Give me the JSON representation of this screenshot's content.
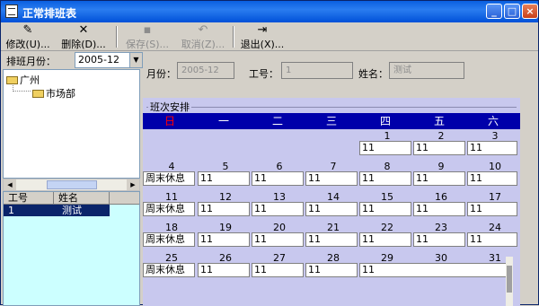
{
  "window": {
    "title": "正常排班表",
    "min": "_",
    "max": "□",
    "close": "×"
  },
  "toolbar": [
    {
      "label": "修改(U)...",
      "icon": "edit-icon",
      "glyph": "✎",
      "enabled": true
    },
    {
      "label": "删除(D)...",
      "icon": "delete-icon",
      "glyph": "✕",
      "enabled": true
    },
    {
      "label": "保存(S)...",
      "icon": "save-icon",
      "glyph": "▪",
      "enabled": false
    },
    {
      "label": "取消(Z)...",
      "icon": "undo-icon",
      "glyph": "↶",
      "enabled": false
    },
    {
      "label": "退出(X)...",
      "icon": "exit-icon",
      "glyph": "⇥",
      "enabled": true
    }
  ],
  "month": {
    "label": "排班月份：",
    "value": "2005-12"
  },
  "tree": {
    "root": "广州",
    "child": "市场部"
  },
  "employees": {
    "headers": [
      "工号",
      "姓名"
    ],
    "rows": [
      {
        "id": "1",
        "name": "测试"
      }
    ]
  },
  "form": {
    "month_label": "月份：",
    "month_value": "2005-12",
    "id_label": "工号：",
    "id_value": "1",
    "name_label": "姓名：",
    "name_value": "测试"
  },
  "schedule": {
    "title": "班次安排",
    "days": [
      "日",
      "一",
      "二",
      "三",
      "四",
      "五",
      "六"
    ],
    "weekend_note": "周末休息",
    "shift": "11",
    "weeks": [
      [
        null,
        null,
        null,
        null,
        1,
        2,
        3
      ],
      [
        4,
        5,
        6,
        7,
        8,
        9,
        10
      ],
      [
        11,
        12,
        13,
        14,
        15,
        16,
        17
      ],
      [
        18,
        19,
        20,
        21,
        22,
        23,
        24
      ],
      [
        25,
        26,
        27,
        28,
        29,
        30,
        31
      ]
    ]
  },
  "colors": {
    "header_bg": "#0000aa",
    "sunday": "#ff0000",
    "schedule_bg": "#c8c8ee",
    "list_bg": "#ccffff"
  }
}
